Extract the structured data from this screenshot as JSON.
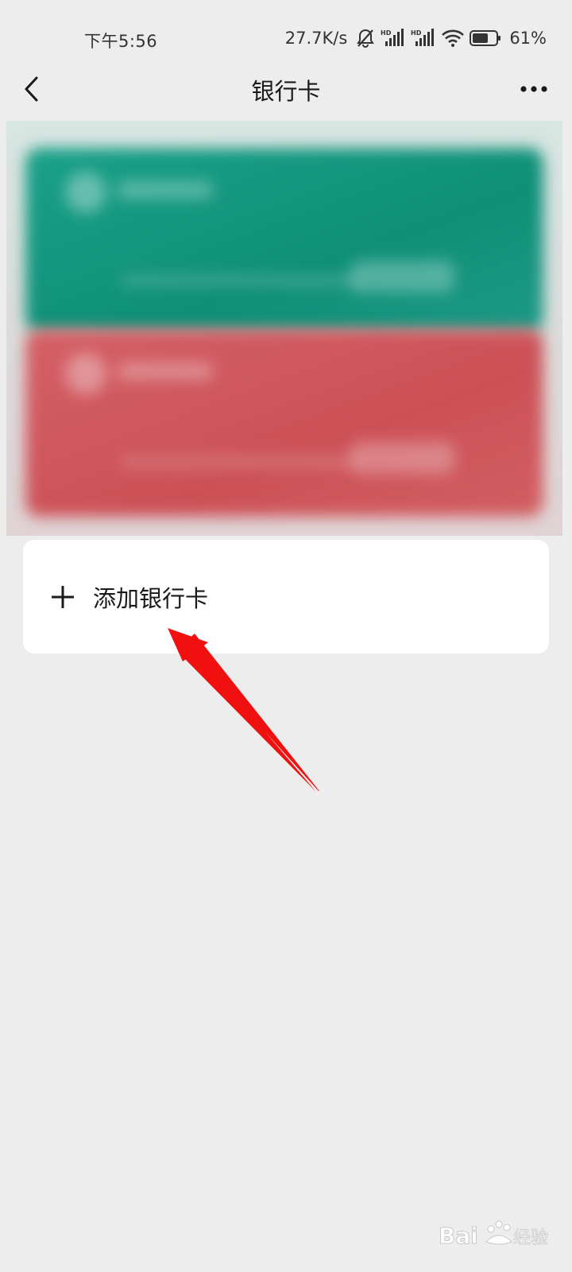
{
  "status_bar": {
    "time": "下午5:56",
    "net_speed": "27.7K/s",
    "battery_percent": "61%",
    "icons": [
      "mute-bell-icon",
      "hd-signal-icon",
      "hd-signal-icon",
      "wifi-icon",
      "battery-icon"
    ]
  },
  "nav": {
    "title": "银行卡",
    "back_icon": "chevron-left-icon",
    "more_icon": "ellipsis-icon"
  },
  "cards": [
    {
      "color": "#13957f"
    },
    {
      "color": "#cf565c"
    }
  ],
  "add_card": {
    "label": "添加银行卡",
    "icon": "plus-icon"
  },
  "annotation": {
    "color": "#f01010"
  },
  "watermark": {
    "text": "Baidu经验"
  }
}
